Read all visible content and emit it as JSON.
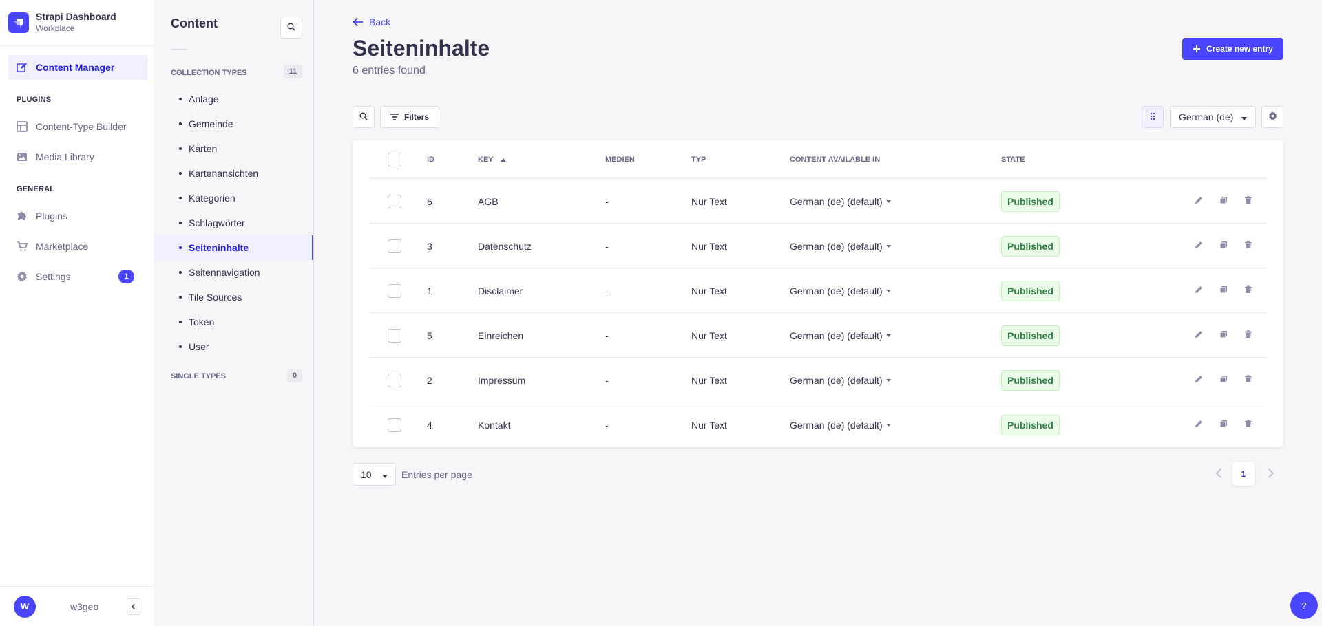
{
  "brand": {
    "title": "Strapi Dashboard",
    "subtitle": "Workplace",
    "icon": "strapi-logo"
  },
  "nav": {
    "content_manager": "Content Manager",
    "plugins_section": "Plugins",
    "content_type_builder": "Content-Type Builder",
    "media_library": "Media Library",
    "general_section": "General",
    "plugins": "Plugins",
    "marketplace": "Marketplace",
    "settings": "Settings",
    "settings_badge": "1"
  },
  "user": {
    "initial": "W",
    "name": "w3geo"
  },
  "subnav": {
    "title": "Content",
    "collection_types_label": "Collection types",
    "collection_types_count": "11",
    "items": [
      "Anlage",
      "Gemeinde",
      "Karten",
      "Kartenansichten",
      "Kategorien",
      "Schlagwörter",
      "Seiteninhalte",
      "Seitennavigation",
      "Tile Sources",
      "Token",
      "User"
    ],
    "active_item": "Seiteninhalte",
    "single_types_label": "Single types",
    "single_types_count": "0"
  },
  "page": {
    "back_label": "Back",
    "title": "Seiteninhalte",
    "subtitle": "6 entries found",
    "create_label": "Create new entry"
  },
  "toolbar": {
    "filters_label": "Filters",
    "locale": "German (de)"
  },
  "table": {
    "columns": [
      "ID",
      "Key",
      "Medien",
      "Typ",
      "Content available in",
      "State"
    ],
    "rows": [
      {
        "id": "6",
        "key": "AGB",
        "medien": "-",
        "typ": "Nur Text",
        "locale": "German (de) (default)",
        "state": "Published"
      },
      {
        "id": "3",
        "key": "Datenschutz",
        "medien": "-",
        "typ": "Nur Text",
        "locale": "German (de) (default)",
        "state": "Published"
      },
      {
        "id": "1",
        "key": "Disclaimer",
        "medien": "-",
        "typ": "Nur Text",
        "locale": "German (de) (default)",
        "state": "Published"
      },
      {
        "id": "5",
        "key": "Einreichen",
        "medien": "-",
        "typ": "Nur Text",
        "locale": "German (de) (default)",
        "state": "Published"
      },
      {
        "id": "2",
        "key": "Impressum",
        "medien": "-",
        "typ": "Nur Text",
        "locale": "German (de) (default)",
        "state": "Published"
      },
      {
        "id": "4",
        "key": "Kontakt",
        "medien": "-",
        "typ": "Nur Text",
        "locale": "German (de) (default)",
        "state": "Published"
      }
    ]
  },
  "pagination": {
    "per_page": "10",
    "per_page_label": "Entries per page",
    "current_page": "1"
  },
  "help_label": "?",
  "colors": {
    "primary": "#4945ff",
    "published_bg": "#eafbe7",
    "published_text": "#328048"
  }
}
